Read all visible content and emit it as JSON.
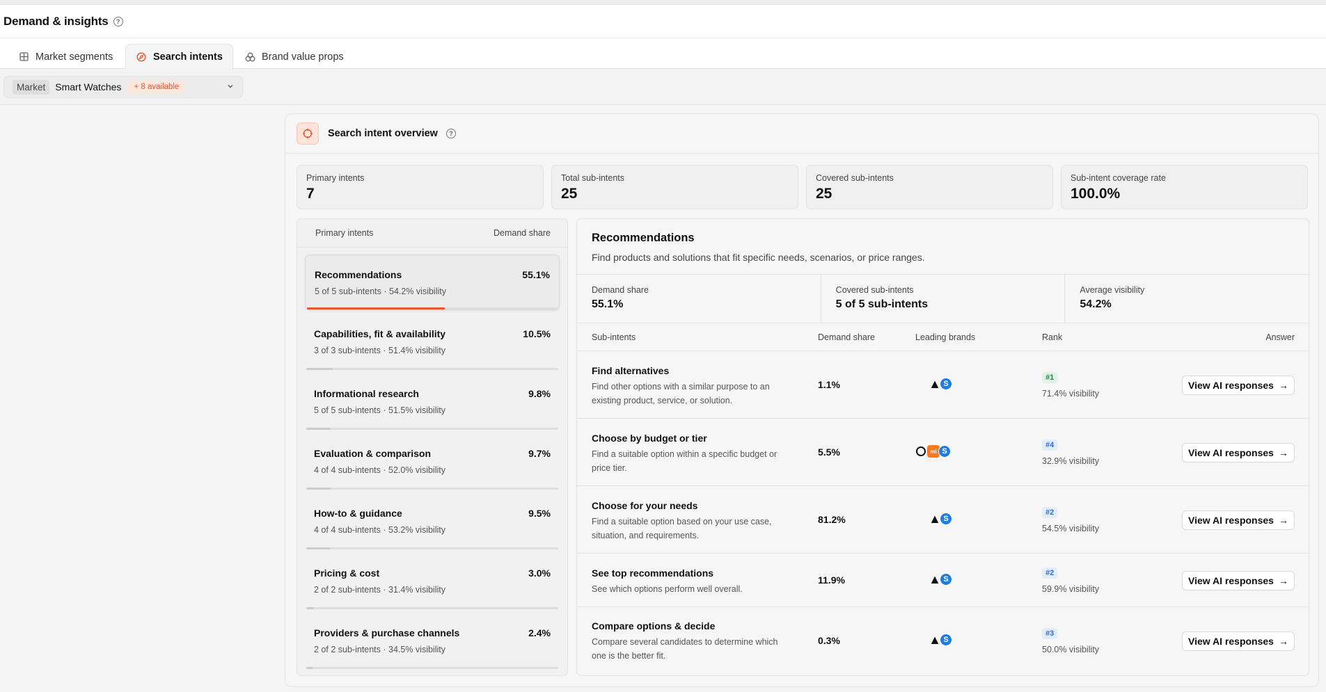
{
  "header": {
    "title": "Demand & insights"
  },
  "tabs": [
    {
      "label": "Market segments",
      "icon": "grid-icon"
    },
    {
      "label": "Search intents",
      "icon": "compass-icon"
    },
    {
      "label": "Brand value props",
      "icon": "layers-icon"
    }
  ],
  "filter": {
    "market_label": "Market",
    "market_value": "Smart Watches",
    "available_badge": "+ 8 available"
  },
  "overview": {
    "title": "Search intent overview",
    "stats": [
      {
        "label": "Primary intents",
        "value": "7"
      },
      {
        "label": "Total sub-intents",
        "value": "25"
      },
      {
        "label": "Covered sub-intents",
        "value": "25"
      },
      {
        "label": "Sub-intent coverage rate",
        "value": "100.0%"
      }
    ]
  },
  "intents_panel": {
    "col_left": "Primary intents",
    "col_right": "Demand share",
    "items": [
      {
        "name": "Recommendations",
        "share": "55.1%",
        "meta": "5 of 5 sub-intents · 54.2% visibility",
        "bar_fraction": 0.551
      },
      {
        "name": "Capabilities, fit & availability",
        "share": "10.5%",
        "meta": "3 of 3 sub-intents · 51.4% visibility",
        "bar_fraction": 0.105
      },
      {
        "name": "Informational research",
        "share": "9.8%",
        "meta": "5 of 5 sub-intents · 51.5% visibility",
        "bar_fraction": 0.098
      },
      {
        "name": "Evaluation & comparison",
        "share": "9.7%",
        "meta": "4 of 4 sub-intents · 52.0% visibility",
        "bar_fraction": 0.097
      },
      {
        "name": "How-to & guidance",
        "share": "9.5%",
        "meta": "4 of 4 sub-intents · 53.2% visibility",
        "bar_fraction": 0.095
      },
      {
        "name": "Pricing & cost",
        "share": "3.0%",
        "meta": "2 of 2 sub-intents · 31.4% visibility",
        "bar_fraction": 0.03
      },
      {
        "name": "Providers & purchase channels",
        "share": "2.4%",
        "meta": "2 of 2 sub-intents · 34.5% visibility",
        "bar_fraction": 0.024
      }
    ]
  },
  "detail": {
    "title": "Recommendations",
    "description": "Find products and solutions that fit specific needs, scenarios, or price ranges.",
    "stats": [
      {
        "label": "Demand share",
        "value": "55.1%"
      },
      {
        "label": "Covered sub-intents",
        "value": "5 of 5 sub-intents"
      },
      {
        "label": "Average visibility",
        "value": "54.2%"
      }
    ],
    "table_headers": {
      "sub_intents": "Sub-intents",
      "demand_share": "Demand share",
      "leading_brands": "Leading brands",
      "rank": "Rank",
      "answer": "Answer"
    },
    "rows": [
      {
        "name": "Find alternatives",
        "desc": "Find other options with a similar purpose to an existing product, service, or solution.",
        "share": "1.1%",
        "brands": [
          "apple-logo-icon",
          "garmin-logo-icon",
          "samsung-logo-icon"
        ],
        "rank": "#1",
        "rank_color": "#1f8a3a",
        "visibility": "71.4% visibility",
        "button": "View AI responses"
      },
      {
        "name": "Choose by budget or tier",
        "desc": "Find a suitable option within a specific budget or price tier.",
        "share": "5.5%",
        "brands": [
          "amazfit-logo-icon",
          "xiaomi-logo-icon",
          "samsung-logo-icon"
        ],
        "rank": "#4",
        "rank_color": "#2d6cd4",
        "visibility": "32.9% visibility",
        "button": "View AI responses"
      },
      {
        "name": "Choose for your needs",
        "desc": "Find a suitable option based on your use case, situation, and requirements.",
        "share": "81.2%",
        "brands": [
          "apple-logo-icon",
          "garmin-logo-icon",
          "samsung-logo-icon"
        ],
        "rank": "#2",
        "rank_color": "#2d6cd4",
        "visibility": "54.5% visibility",
        "button": "View AI responses"
      },
      {
        "name": "See top recommendations",
        "desc": "See which options perform well overall.",
        "share": "11.9%",
        "brands": [
          "apple-logo-icon",
          "garmin-logo-icon",
          "samsung-logo-icon"
        ],
        "rank": "#2",
        "rank_color": "#2d6cd4",
        "visibility": "59.9% visibility",
        "button": "View AI responses"
      },
      {
        "name": "Compare options & decide",
        "desc": "Compare several candidates to determine which one is the better fit.",
        "share": "0.3%",
        "brands": [
          "apple-logo-icon",
          "garmin-logo-icon",
          "samsung-logo-icon"
        ],
        "rank": "#3",
        "rank_color": "#2d6cd4",
        "visibility": "50.0% visibility",
        "button": "View AI responses"
      }
    ]
  },
  "colors": {
    "accent": "#e8562a",
    "rank_green": "#1f8a3a",
    "rank_blue": "#2d6cd4"
  }
}
